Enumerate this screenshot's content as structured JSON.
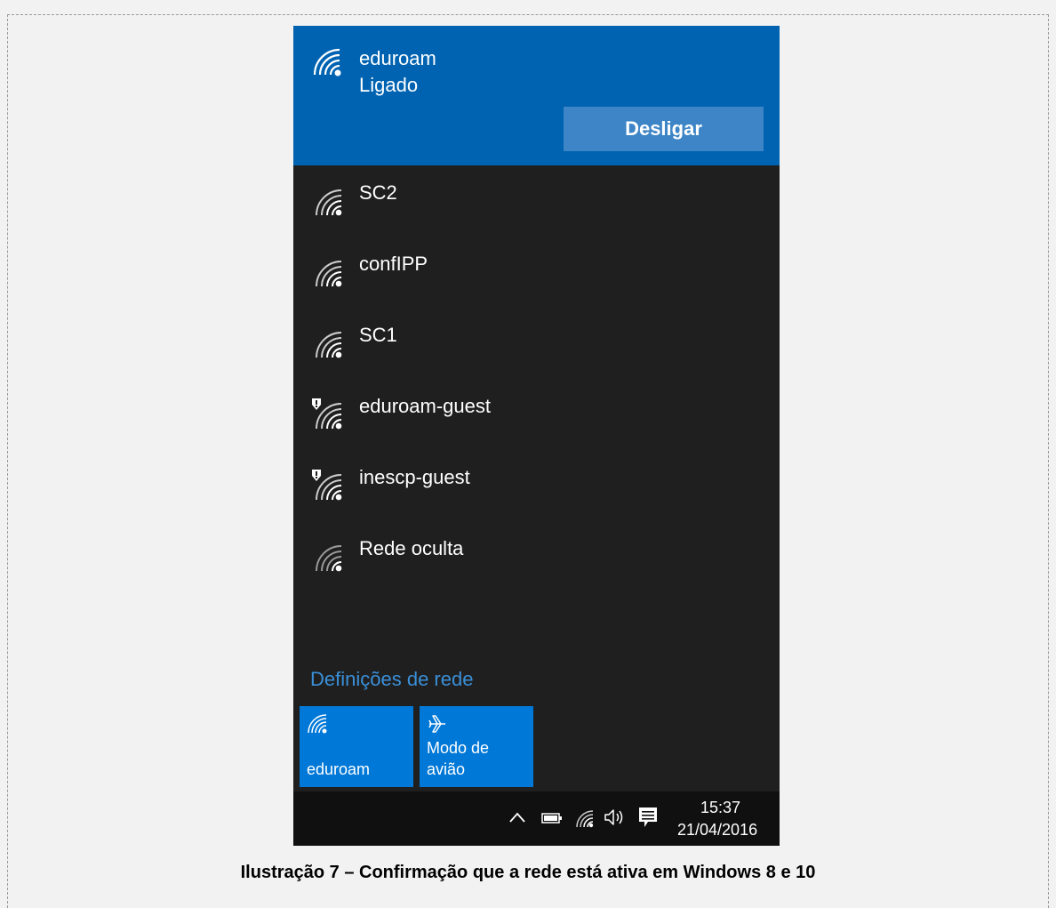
{
  "connected_network": {
    "name": "eduroam",
    "status": "Ligado",
    "disconnect_label": "Desligar"
  },
  "networks": [
    {
      "name": "SC2",
      "icon": "wifi-signal-icon"
    },
    {
      "name": "confIPP",
      "icon": "wifi-signal-icon"
    },
    {
      "name": "SC1",
      "icon": "wifi-signal-icon"
    },
    {
      "name": "eduroam-guest",
      "icon": "wifi-signal-unsecured-icon"
    },
    {
      "name": "inescp-guest",
      "icon": "wifi-signal-unsecured-icon"
    },
    {
      "name": "Rede oculta",
      "icon": "wifi-signal-icon"
    }
  ],
  "settings_link": "Definições de rede",
  "quick_actions": [
    {
      "label": "eduroam",
      "icon": "wifi-icon"
    },
    {
      "label_line1": "Modo de",
      "label_line2": "avião",
      "icon": "airplane-icon"
    }
  ],
  "taskbar": {
    "time": "15:37",
    "date": "21/04/2016"
  },
  "caption": "Ilustração 7 – Confirmação que a rede está ativa em Windows 8 e 10",
  "colors": {
    "accent_dark": "#0063b1",
    "accent_tile": "#0078d7",
    "panel_bg": "#1f1f1f",
    "link": "#3a8fd8"
  }
}
